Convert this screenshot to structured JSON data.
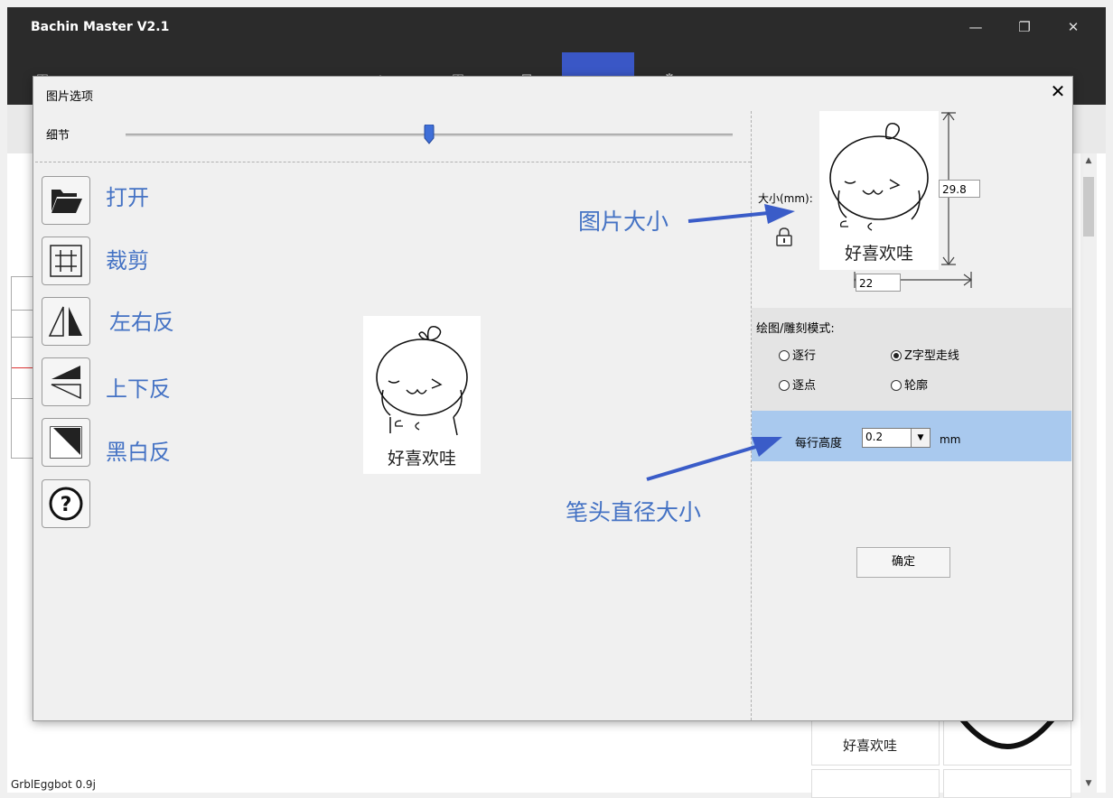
{
  "app": {
    "title": "Bachin Master V2.1",
    "status_text": "GrblEggbot 0.9j",
    "window_controls": [
      "minimize-icon",
      "restore-icon",
      "close-icon"
    ],
    "minimize_glyph": "—",
    "restore_glyph": "❐",
    "close_glyph": "✕"
  },
  "dialog": {
    "title": "图片选项",
    "close_glyph": "✕",
    "detail_label": "细节",
    "detail_level": 0.5,
    "tools": [
      {
        "label": "打开",
        "icon": "folder-open-icon"
      },
      {
        "label": "裁剪",
        "icon": "crop-icon"
      },
      {
        "label": "左右反",
        "icon": "flip-horizontal-icon"
      },
      {
        "label": "上下反",
        "icon": "flip-vertical-icon"
      },
      {
        "label": "黑白反",
        "icon": "invert-color-icon"
      },
      {
        "label": "",
        "icon": "help-icon"
      }
    ],
    "preview_caption": "好喜欢哇",
    "size_label": "大小(mm):",
    "height_value": "29.8",
    "width_value": "22",
    "mode_title": "绘图/雕刻模式:",
    "modes": [
      {
        "label": "逐行",
        "selected": false
      },
      {
        "label": "Z字型走线",
        "selected": true
      },
      {
        "label": "逐点",
        "selected": false
      },
      {
        "label": "轮廓",
        "selected": false
      }
    ],
    "row_height_label": "每行高度",
    "row_height_value": "0.2",
    "row_height_unit": "mm",
    "ok_label": "确定"
  },
  "annotations": {
    "image_size": "图片大小",
    "pen_diameter": "笔头直径大小"
  },
  "colors": {
    "annotation_blue": "#4472c4",
    "title_bar": "#2b2b2b",
    "active_tab": "#3a57c6",
    "row_panel": "#a9c9ee"
  }
}
